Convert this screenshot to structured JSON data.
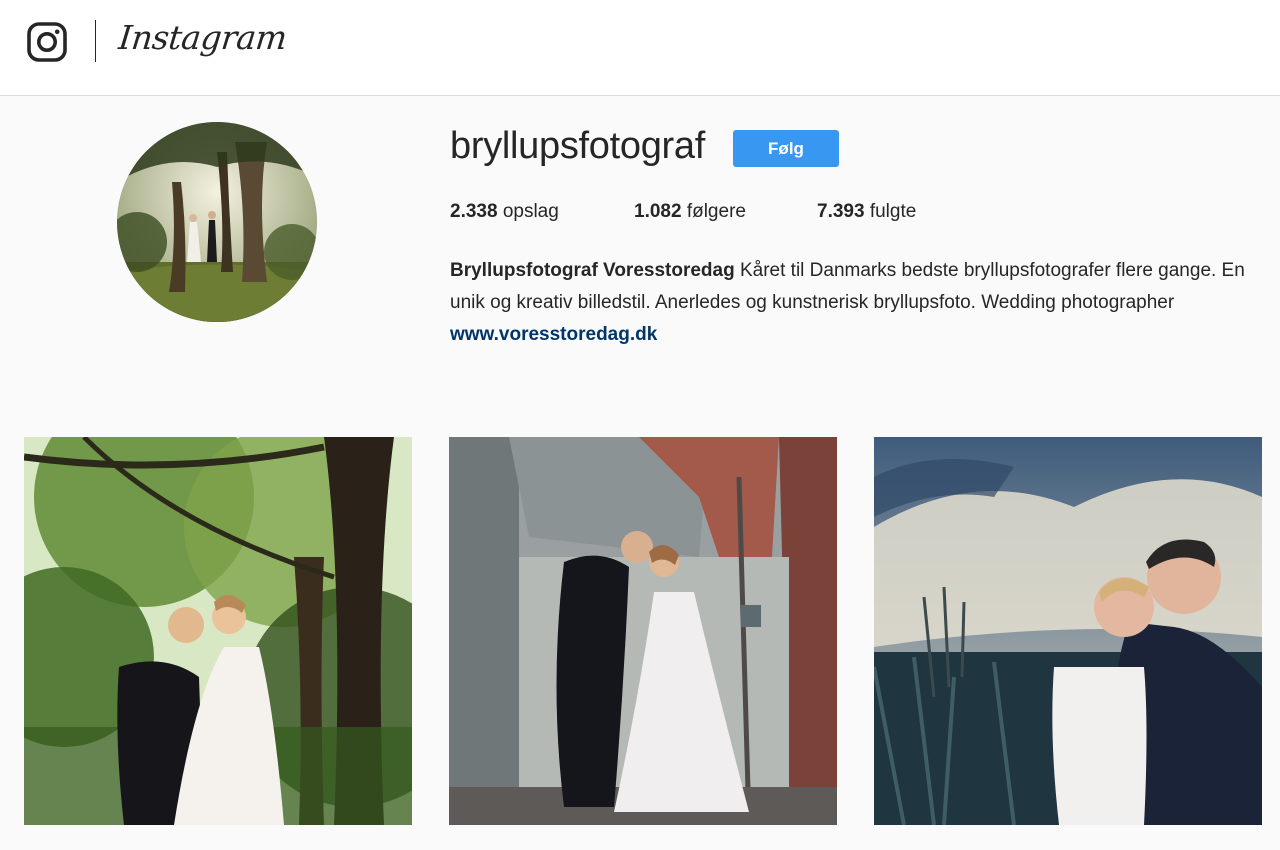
{
  "header": {
    "logo_icon": "instagram-glyph-icon",
    "wordmark": "Instagram"
  },
  "profile": {
    "username": "bryllupsfotograf",
    "follow_label": "Følg",
    "stats": [
      {
        "count": "2.338",
        "label": "opslag"
      },
      {
        "count": "1.082",
        "label": "følgere"
      },
      {
        "count": "7.393",
        "label": "fulgte"
      }
    ],
    "bio_name": "Bryllupsfotograf Voresstoredag",
    "bio_text": "Kåret til Danmarks bedste bryllupsfotografer flere gange. En unik og kreativ billedstil. Anerledes og kunstnerisk bryllupsfoto. Wedding photographer",
    "website": "www.voresstoredag.dk"
  },
  "colors": {
    "accent": "#3897f0",
    "link": "#003569",
    "text": "#262626",
    "background": "#fafafa"
  }
}
